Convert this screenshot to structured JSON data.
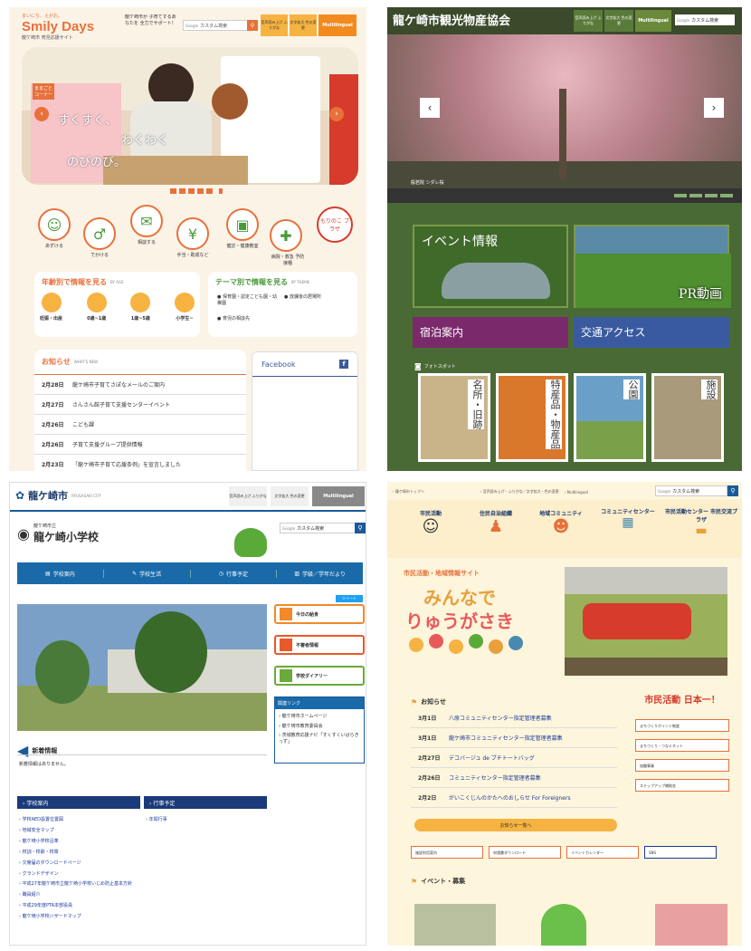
{
  "p1": {
    "tagline": "まいにち、えがお。",
    "logo": "Smily Days",
    "subtitle": "龍ケ崎市 育児応援サイト",
    "slogan": "龍ケ崎市が 子育てするあなたを 全力でサポート！",
    "search_placeholder": "カスタム検索",
    "search_brand": "Google",
    "tools": [
      "音声読み上げ ふりがな",
      "文字拡大 色の変更"
    ],
    "multilingual": "Multilingual",
    "hero_sign": "ままごと コーナー",
    "hero_copy": [
      "すくすく、",
      "わくわく",
      "のびのび。"
    ],
    "nav": [
      "あずける",
      "でかける",
      "相談する",
      "手当・助成など",
      "健診・健康教室",
      "病院・救急 予防接種",
      "もりのこ プラザ"
    ],
    "age_title": "年齢別で情報を見る",
    "age_title_en": "BY AGE",
    "ages": [
      "妊娠・出産",
      "0歳~1歳",
      "1歳~5歳",
      "小学生~"
    ],
    "theme_title": "テーマ別で情報を見る",
    "theme_title_en": "BY THEME",
    "themes": [
      "保育園・認定こども園・幼稚園",
      "放課後の居場所",
      "育児の相談先"
    ],
    "news_title": "お知らせ",
    "news_title_en": "WHAT'S NEW",
    "news": [
      {
        "date": "2月28日",
        "text": "龍ケ崎市子育てさぽなメールのご案内"
      },
      {
        "date": "2月27日",
        "text": "さんさん館子育て支援センターイベント"
      },
      {
        "date": "2月26日",
        "text": "こども課"
      },
      {
        "date": "2月26日",
        "text": "子育て支援グループ提供情報"
      },
      {
        "date": "2月23日",
        "text": "「龍ケ崎市子育て応援条例」を宣言しました"
      }
    ],
    "facebook": "Facebook"
  },
  "p2": {
    "title": "龍ケ崎市観光物産協会",
    "tools": [
      "音声読み上げ ふりがな",
      "文字拡大 色の変更"
    ],
    "multilingual": "Multilingual",
    "search_placeholder": "カスタム検索",
    "search_brand": "Google",
    "caption": "般若院 シダレ桜",
    "event": "イベント情報",
    "pr": "PR動画",
    "stay": "宿泊案内",
    "access": "交通アクセス",
    "photo_label": "フォトスポット",
    "tiles": [
      "名所・旧跡",
      "特産品・物産品",
      "公園",
      "施設"
    ]
  },
  "p3": {
    "city": "龍ケ崎市",
    "city_en": "RYUGASAKI CITY",
    "tools": [
      "音声読み上げ ふりがな",
      "文字拡大 色の変更"
    ],
    "multilingual": "Multilingual",
    "school_pre": "龍ケ崎市立",
    "school": "龍ケ崎小学校",
    "search_placeholder": "カスタム検索",
    "search_brand": "Google",
    "nav": [
      "学校案内",
      "学校生活",
      "行事予定",
      "学級／学年だより"
    ],
    "side": [
      "今日の給食",
      "不審者情報",
      "学校ダイアリー"
    ],
    "links_title": "関連リンク",
    "links": [
      "龍ケ崎市ホームページ",
      "龍ケ崎市教育委員会",
      "茨城教育応援ナビ「すくすくいばらきっず」"
    ],
    "news_title": "新着情報",
    "news_empty": "新着情報はありません。",
    "col1_title": "学校案内",
    "col2_title": "行事予定",
    "col1": [
      "学校AED設置位置図",
      "地域安全マップ",
      "龍ケ崎小学校沿革",
      "校訓・校歌・校章",
      "欠席届のダウンロードページ",
      "グランドデザイン",
      "平成27年龍ケ崎市立龍ケ崎小学校いじめ防止基本方針",
      "職員紹介",
      "平成29年度PTA本部役員",
      "龍ケ崎小学校ハザードマップ"
    ],
    "col2": [
      "年間行事"
    ],
    "tweet": "ツイート"
  },
  "p4": {
    "top_links": [
      "龍ケ崎市トップへ",
      "音声読み上げ・ふりがな／文字拡大・色の変更",
      "Multilingual"
    ],
    "search_placeholder": "カスタム検索",
    "search_brand": "Google",
    "nav": [
      "市民活動",
      "住民自治組織",
      "地域コミュニティ",
      "コミュニティセンター",
      "市民活動センター 市民交流プラザ"
    ],
    "site_sub": "市民活動・地域情報サイト",
    "site_title_1": "みんなで",
    "site_title_2": "りゅうがさき",
    "news_title": "お知らせ",
    "news": [
      {
        "date": "3月1日",
        "text": "八原コミュニティセンター指定管理者募集"
      },
      {
        "date": "3月1日",
        "text": "龍ケ崎市コミュニティセンター指定管理者募集"
      },
      {
        "date": "2月27日",
        "text": "デコバージュ de ブチトートバッグ"
      },
      {
        "date": "2月26日",
        "text": "コミュニティセンター指定管理者募集"
      },
      {
        "date": "2月2日",
        "text": "がいこくじんのかたへのおしらせ For Foreigners"
      }
    ],
    "news_more": "お知らせ一覧へ",
    "nihon": "市民活動 日本一！",
    "side": [
      "まちづくりポイント制度",
      "まちづくり・つなぐネット",
      "協働事業",
      "ステップアップ補助金"
    ],
    "bottom": [
      "施設利用案内",
      "申請書ダウンロード",
      "イベントカレンダー",
      "SNS"
    ],
    "event_title": "イベント・募集"
  }
}
